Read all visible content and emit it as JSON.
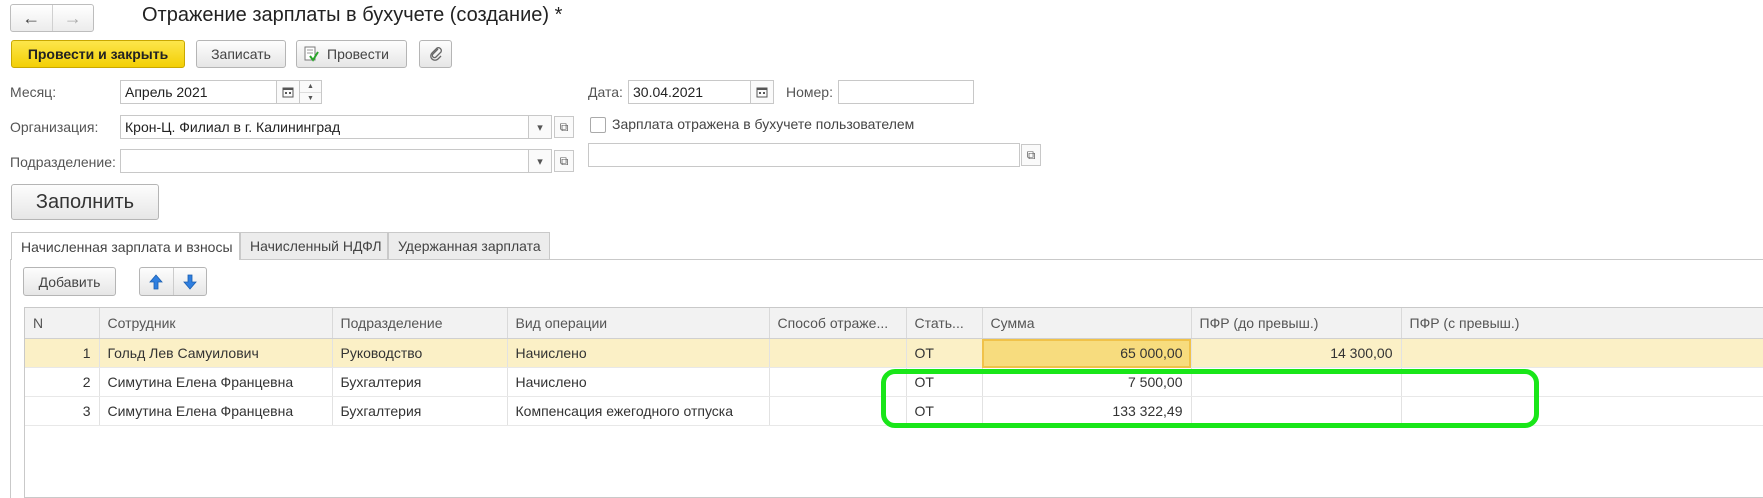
{
  "window": {
    "title": "Отражение зарплаты в бухучете (создание) *",
    "back_icon": "←",
    "forward_icon": "→"
  },
  "toolbar": {
    "post_and_close": "Провести и закрыть",
    "save": "Записать",
    "post": "Провести",
    "attach_icon": "paperclip-icon"
  },
  "form": {
    "month_label": "Месяц:",
    "month_value": "Апрель 2021",
    "org_label": "Организация:",
    "org_value": "Крон-Ц. Филиал в г. Калининград",
    "dept_label": "Подразделение:",
    "dept_value": "",
    "date_label": "Дата:",
    "date_value": "30.04.2021",
    "number_label": "Номер:",
    "number_value": "",
    "reflected_checkbox_label": "Зарплата отражена в бухучете пользователем",
    "reflected_checked": false,
    "user_field_value": "",
    "fill_button": "Заполнить"
  },
  "tabs": [
    {
      "label": "Начисленная зарплата и взносы",
      "active": true
    },
    {
      "label": "Начисленный НДФЛ",
      "active": false
    },
    {
      "label": "Удержанная зарплата",
      "active": false
    }
  ],
  "table_toolbar": {
    "add": "Добавить"
  },
  "table": {
    "columns": [
      "N",
      "Сотрудник",
      "Подразделение",
      "Вид операции",
      "Способ отраже...",
      "Стать...",
      "Сумма",
      "ПФР (до превыш.)",
      "ПФР (с превыш.)"
    ],
    "rows": [
      [
        "1",
        "Гольд Лев Самуилович",
        "Руководство",
        "Начислено",
        "",
        "ОТ",
        "65 000,00",
        "14 300,00",
        ""
      ],
      [
        "2",
        "Симутина Елена Францевна",
        "Бухгалтерия",
        "Начислено",
        "",
        "ОТ",
        "7 500,00",
        "",
        ""
      ],
      [
        "3",
        "Симутина Елена Францевна",
        "Бухгалтерия",
        "Компенсация ежегодного отпуска",
        "",
        "ОТ",
        "133 322,49",
        "",
        ""
      ]
    ]
  },
  "colors": {
    "primary_button": "#f3cf05",
    "selected_row": "#fbf0c6",
    "highlight_frame": "#19e619"
  }
}
